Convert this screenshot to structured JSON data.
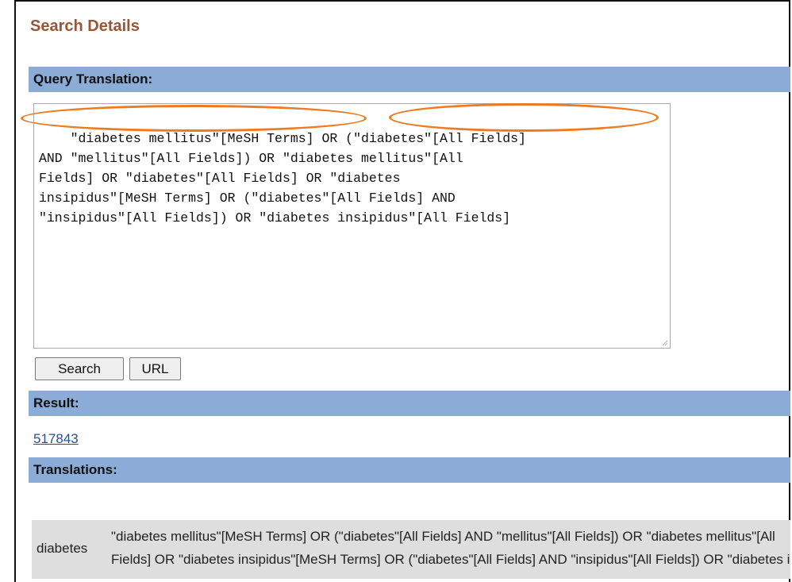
{
  "page": {
    "heading": "Search Details"
  },
  "query": {
    "header": "Query Translation:",
    "text": "\"diabetes mellitus\"[MeSH Terms] OR (\"diabetes\"[All Fields]\nAND \"mellitus\"[All Fields]) OR \"diabetes mellitus\"[All\nFields] OR \"diabetes\"[All Fields] OR \"diabetes\ninsipidus\"[MeSH Terms] OR (\"diabetes\"[All Fields] AND\n\"insipidus\"[All Fields]) OR \"diabetes insipidus\"[All Fields]"
  },
  "buttons": {
    "search_label": "Search",
    "url_label": "URL"
  },
  "result": {
    "header": "Result:",
    "count": "517843"
  },
  "translations": {
    "header": "Translations:",
    "rows": [
      {
        "term": "diabetes",
        "line1": "\"diabetes mellitus\"[MeSH Terms] OR (\"diabetes\"[All Fields] AND \"mellitus\"[All Fields]) OR \"diabetes mellitus\"[All",
        "line2": "Fields] OR \"diabetes insipidus\"[MeSH Terms] OR (\"diabetes\"[All Fields] AND \"insipidus\"[All Fields]) OR \"diabetes insipidus\"[All Fields]"
      }
    ]
  },
  "colors": {
    "heading": "#985735",
    "section_bar": "#8cacd8",
    "highlight_oval": "#ee7a22",
    "link": "#2e4e8a"
  }
}
